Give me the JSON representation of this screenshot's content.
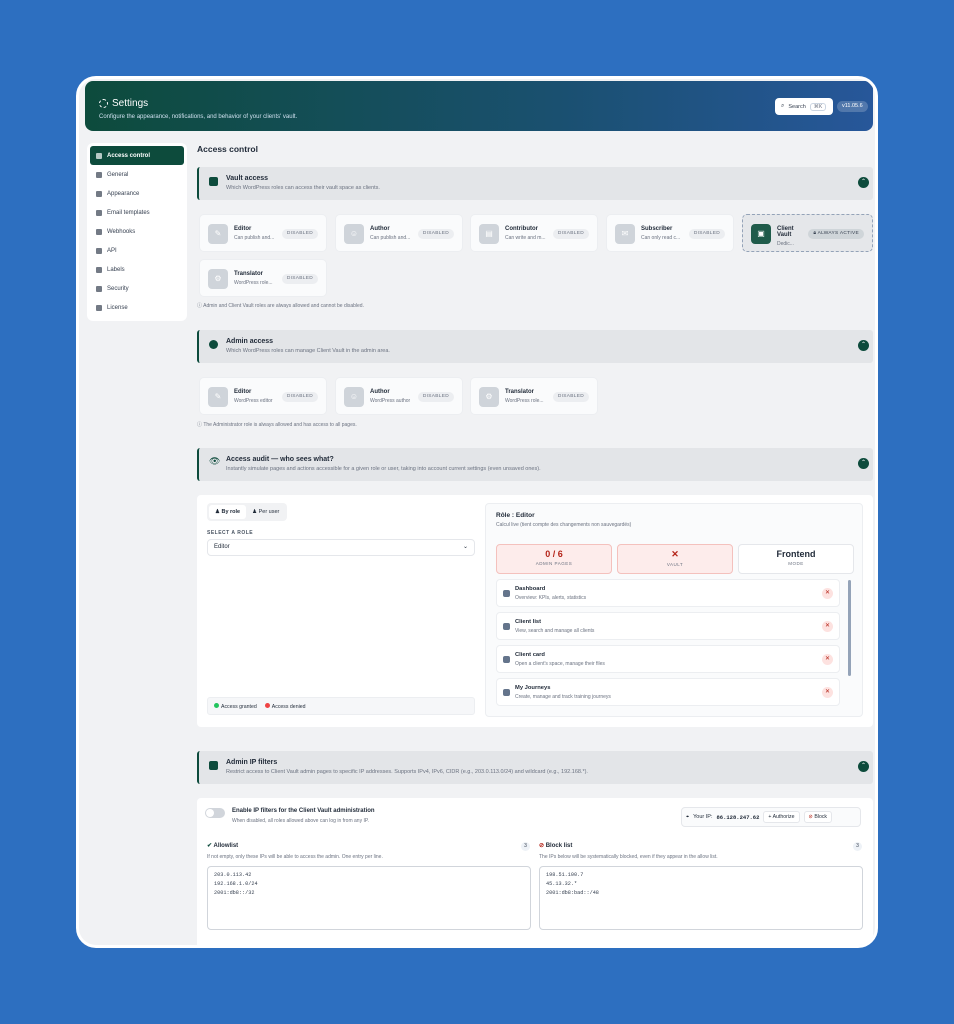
{
  "header": {
    "title": "Settings",
    "subtitle": "Configure the appearance, notifications, and behavior of your clients' vault.",
    "search_label": "Search",
    "search_shortcut": "⌘K",
    "version": "v11.05.6"
  },
  "sidebar": {
    "items": [
      {
        "label": "Access control",
        "icon": "user-icon"
      },
      {
        "label": "General",
        "icon": "grid-icon"
      },
      {
        "label": "Appearance",
        "icon": "brush-icon"
      },
      {
        "label": "Email templates",
        "icon": "mail-icon"
      },
      {
        "label": "Webhooks",
        "icon": "webhook-icon"
      },
      {
        "label": "API",
        "icon": "code-icon"
      },
      {
        "label": "Labels",
        "icon": "tag-icon"
      },
      {
        "label": "Security",
        "icon": "shield-icon"
      },
      {
        "label": "License",
        "icon": "key-icon"
      }
    ]
  },
  "main": {
    "title": "Access control",
    "vault": {
      "title": "Vault access",
      "subtitle": "Which WordPress roles can access their vault space as clients.",
      "roles": [
        {
          "name": "Editor",
          "desc": "Can publish and...",
          "badge": "DISABLED"
        },
        {
          "name": "Author",
          "desc": "Can publish and...",
          "badge": "DISABLED"
        },
        {
          "name": "Contributor",
          "desc": "Can write and m...",
          "badge": "DISABLED"
        },
        {
          "name": "Subscriber",
          "desc": "Can only read c...",
          "badge": "DISABLED"
        },
        {
          "name": "Client Vault",
          "desc": "Dedic...",
          "badge": "ALWAYS ACTIVE"
        },
        {
          "name": "Translator",
          "desc": "WordPress role...",
          "badge": "DISABLED"
        }
      ],
      "note": "Admin and Client Vault roles are always allowed and cannot be disabled."
    },
    "admin": {
      "title": "Admin access",
      "subtitle": "Which WordPress roles can manage Client Vault in the admin area.",
      "roles": [
        {
          "name": "Editor",
          "desc": "WordPress editor",
          "badge": "DISABLED"
        },
        {
          "name": "Author",
          "desc": "WordPress author",
          "badge": "DISABLED"
        },
        {
          "name": "Translator",
          "desc": "WordPress role...",
          "badge": "DISABLED"
        }
      ],
      "note": "The Administrator role is always allowed and has access to all pages."
    },
    "audit": {
      "title": "Access audit — who sees what?",
      "subtitle": "Instantly simulate pages and actions accessible for a given role or user, taking into account current settings (even unsaved ones).",
      "tab_role": "By role",
      "tab_user": "Per user",
      "select_label": "SELECT A ROLE",
      "selected_role": "Editor",
      "legend_granted": "Access granted",
      "legend_denied": "Access denied",
      "result_title": "Rôle : Editor",
      "result_sub": "Calcul live (tient compte des changements non sauvegardés)",
      "stats": [
        {
          "value": "0 / 6",
          "label": "ADMIN PAGES"
        },
        {
          "value": "✕",
          "label": "VAULT"
        },
        {
          "value": "Frontend",
          "label": "MODE"
        }
      ],
      "pages": [
        {
          "title": "Dashboard",
          "desc": "Overview: KPIs, alerts, statistics"
        },
        {
          "title": "Client list",
          "desc": "View, search and manage all clients"
        },
        {
          "title": "Client card",
          "desc": "Open a client's space, manage their files"
        },
        {
          "title": "My Journeys",
          "desc": "Create, manage and track training journeys"
        }
      ]
    },
    "ip": {
      "title": "Admin IP filters",
      "subtitle": "Restrict access to Client Vault admin pages to specific IP addresses. Supports IPv4, IPv6, CIDR (e.g., 203.0.113.0/24) and wildcard (e.g., 192.168.*).",
      "enable_label": "Enable IP filters for the Client Vault administration",
      "enable_desc": "When disabled, all roles allowed above can log in from any IP.",
      "your_ip_label": "Your IP:",
      "your_ip": "86.128.247.62",
      "authorize_label": "+ Authorize",
      "block_label": "Block",
      "allow_title": "Allowlist",
      "allow_desc": "If not empty, only these IPs will be able to access the admin. One entry per line.",
      "allow_count": "3",
      "allow_list": "203.0.113.42\n192.168.1.0/24\n2001:db8::/32",
      "block_title": "Block list",
      "block_desc": "The IPs below will be systematically blocked, even if they appear in the allow list.",
      "block_count": "3",
      "block_list": "198.51.100.7\n45.13.32.*\n2001:db8:bad::/48"
    }
  }
}
